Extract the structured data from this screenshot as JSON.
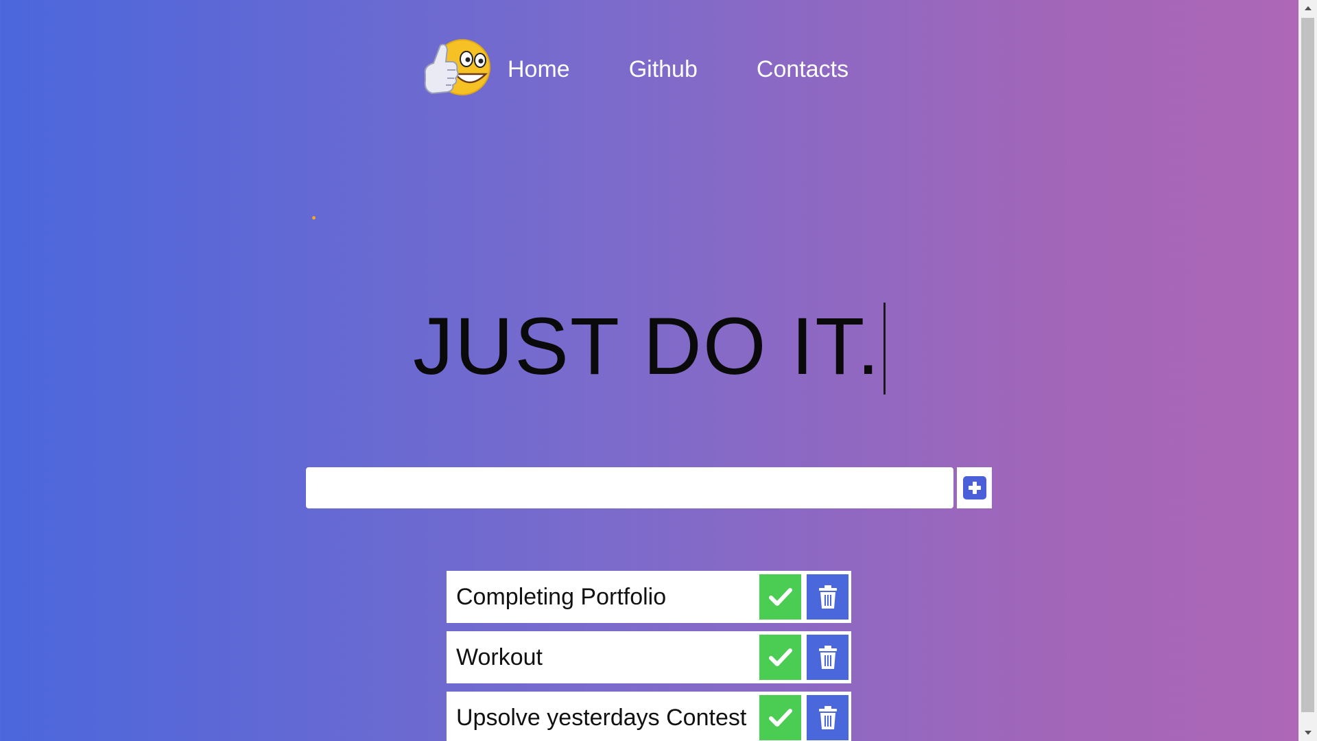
{
  "nav": {
    "logo_icon": "thumbs-up-grinning-emoji-icon",
    "links": [
      "Home",
      "Github",
      "Contacts"
    ]
  },
  "hero": {
    "title": "JUST DO IT."
  },
  "add": {
    "input_value": "",
    "button_icon": "plus-square-icon"
  },
  "todos": [
    {
      "text": "Completing Portfolio"
    },
    {
      "text": "Workout"
    },
    {
      "text": "Upsolve yesterdays Contest"
    }
  ],
  "colors": {
    "gradient_left": "#4b67dc",
    "gradient_right": "#ae67b6",
    "check_button": "#4bcc52",
    "trash_button": "#4a67dc",
    "add_icon": "#4a5fd8"
  }
}
